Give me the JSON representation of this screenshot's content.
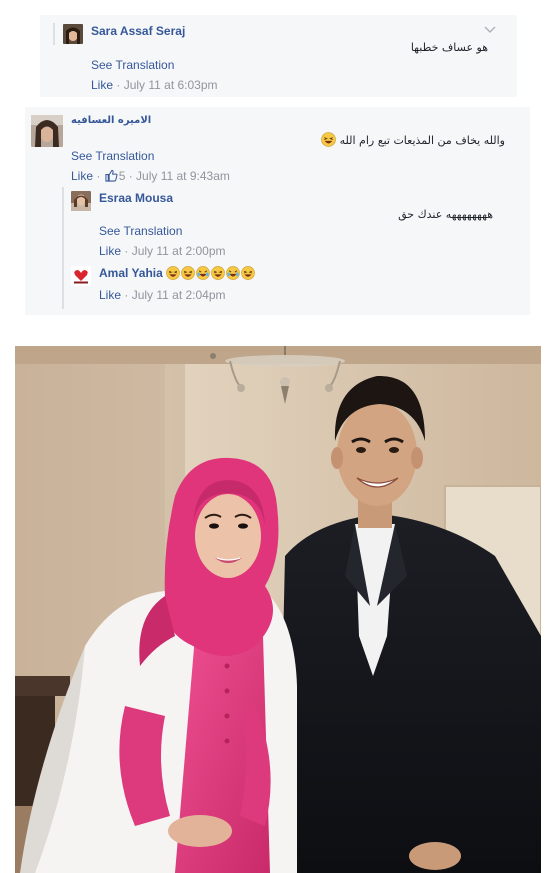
{
  "comments": [
    {
      "author": "Sara Assaf Seraj",
      "text": "هو عساف خطبها",
      "translate_label": "See Translation",
      "like_label": "Like",
      "timestamp": "July 11 at 6:03pm"
    },
    {
      "author": "الاميره العسافيه",
      "text": "والله يخاف من المذيعات تبع رام الله",
      "translate_label": "See Translation",
      "like_label": "Like",
      "like_count": "5",
      "timestamp": "July 11 at 9:43am",
      "replies": [
        {
          "author": "Esraa Mousa",
          "text": "ههههههههه عندك حق",
          "translate_label": "See Translation",
          "like_label": "Like",
          "timestamp": "July 11 at 2:00pm"
        },
        {
          "author": "Amal Yahia",
          "emoji_names": [
            "laughing-emoji",
            "laughing-emoji",
            "crying-laughing-emoji",
            "laughing-emoji",
            "crying-laughing-emoji",
            "laughing-emoji"
          ],
          "like_label": "Like",
          "timestamp": "July 11 at 2:04pm"
        }
      ]
    }
  ],
  "icons": {
    "chevron": "chevron-down-icon",
    "like": "thumbs-up-icon"
  },
  "colors": {
    "link": "#365899",
    "meta": "#90949c",
    "card_bg": "#f6f7f9",
    "hijab_pink": "#e0357a"
  }
}
